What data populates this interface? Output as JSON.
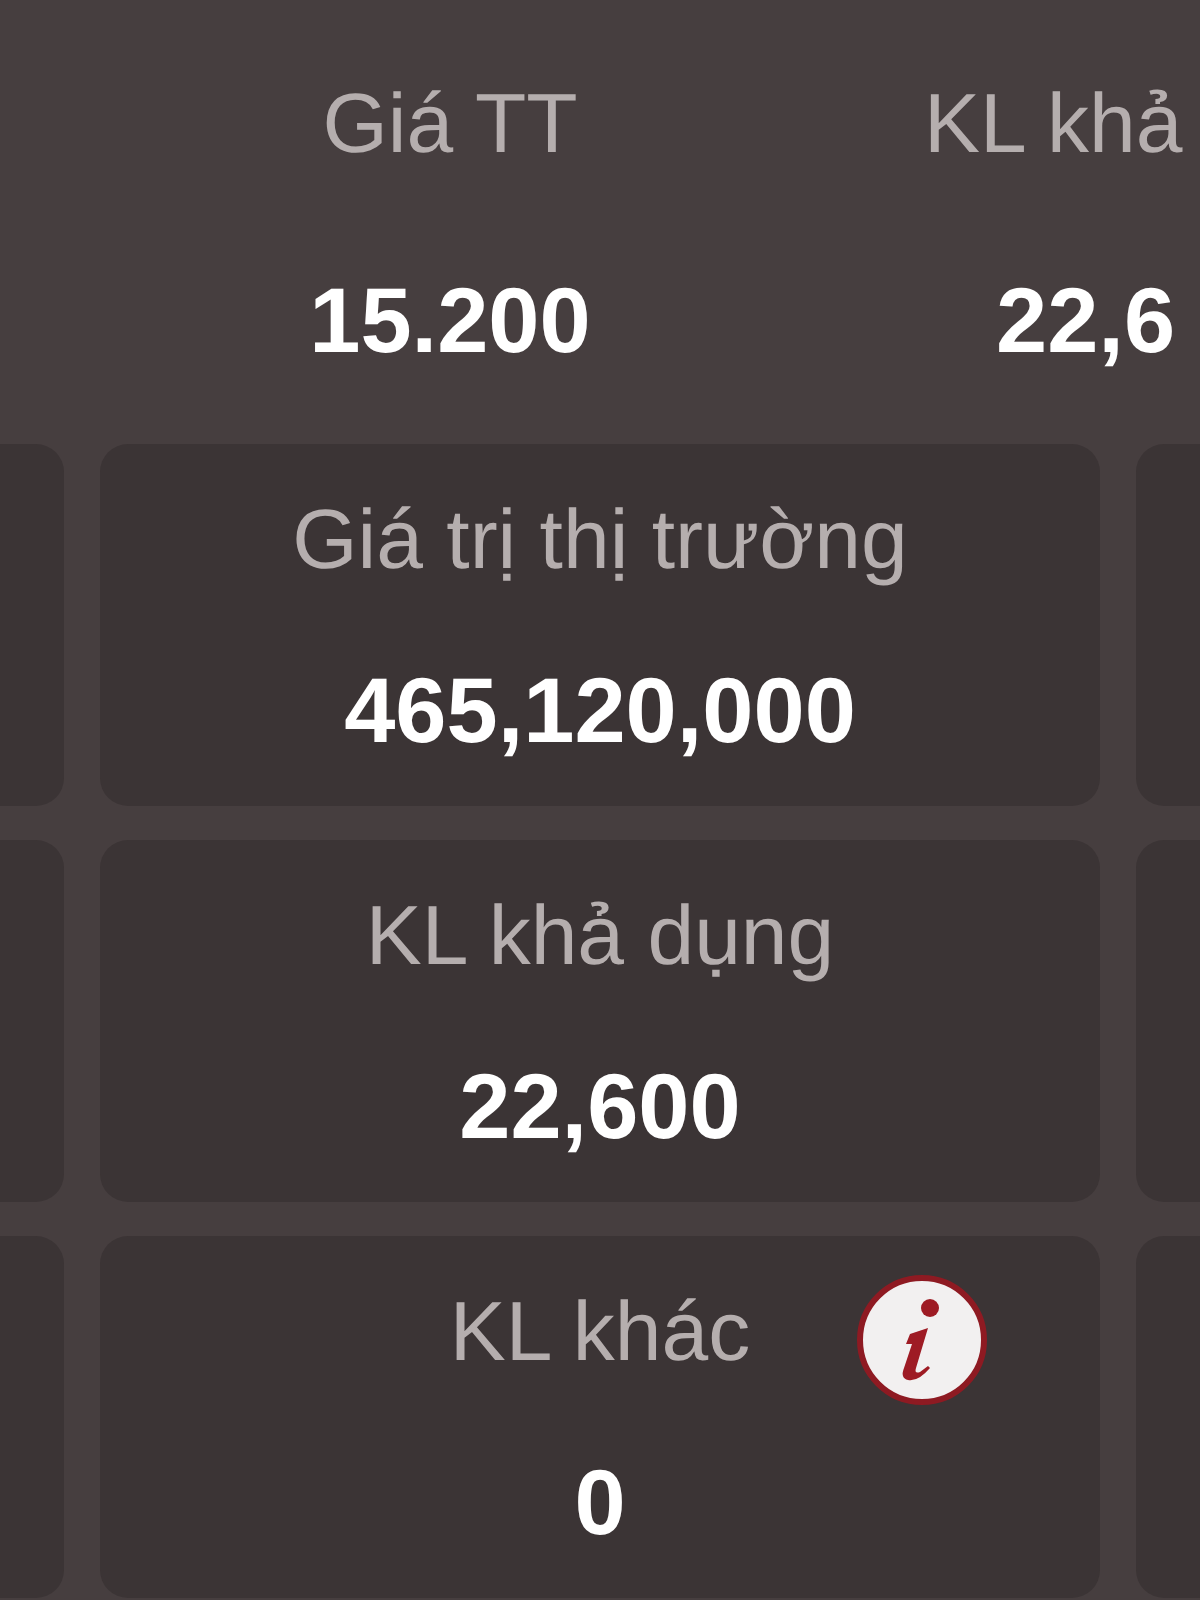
{
  "summary": [
    {
      "label": "Giá TT",
      "value": "15.200"
    },
    {
      "label": "KL khả",
      "value": "22,6"
    }
  ],
  "cards": [
    {
      "label": "Giá trị thị trường",
      "value": "465,120,000",
      "info": false
    },
    {
      "label": "KL khả dụng",
      "value": "22,600",
      "info": false
    },
    {
      "label": "KL khác",
      "value": "0",
      "info": true
    }
  ]
}
